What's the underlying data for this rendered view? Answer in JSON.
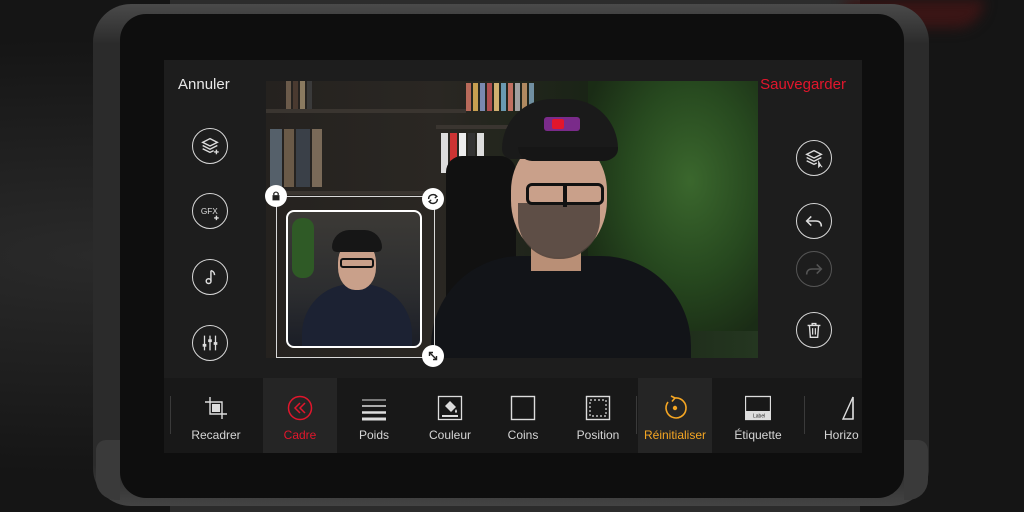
{
  "header": {
    "cancel_label": "Annuler",
    "save_label": "Sauvegarder"
  },
  "left_tools": [
    {
      "name": "add-layer-button",
      "icon": "layers-plus-icon"
    },
    {
      "name": "add-gfx-button",
      "icon": "gfx-plus-icon",
      "text": "GFX"
    },
    {
      "name": "music-button",
      "icon": "music-note-icon"
    },
    {
      "name": "audio-mixer-button",
      "icon": "sliders-icon"
    }
  ],
  "right_tools": [
    {
      "name": "select-layer-button",
      "icon": "layers-select-icon"
    },
    {
      "name": "undo-button",
      "icon": "undo-icon"
    },
    {
      "name": "redo-button",
      "icon": "redo-icon",
      "disabled": true
    },
    {
      "name": "delete-button",
      "icon": "trash-icon"
    }
  ],
  "toolbar": {
    "items": [
      {
        "label": "Recadrer",
        "icon": "crop-icon"
      },
      {
        "label": "Cadre",
        "icon": "frame-chevrons-icon",
        "state": "active"
      },
      {
        "label": "Poids",
        "icon": "line-weight-icon"
      },
      {
        "label": "Couleur",
        "icon": "paint-bucket-icon"
      },
      {
        "label": "Coins",
        "icon": "square-corners-icon"
      },
      {
        "label": "Position",
        "icon": "dashed-square-icon"
      },
      {
        "label": "Réinitialiser",
        "icon": "reset-icon",
        "state": "highlight"
      },
      {
        "label": "Étiquette",
        "icon": "label-tag-icon",
        "icon_text": "Label"
      },
      {
        "label": "Horizo",
        "icon": "horizon-flip-icon"
      }
    ]
  },
  "colors": {
    "accent_red": "#e2162c",
    "accent_orange": "#f5a623",
    "text": "#d6d6d6"
  }
}
